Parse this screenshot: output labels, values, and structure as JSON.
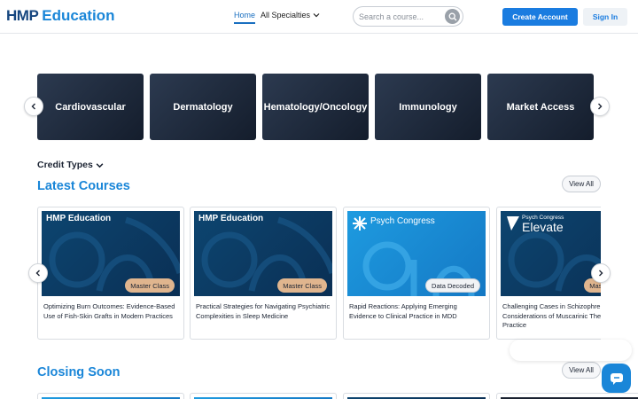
{
  "header": {
    "logo_prefix": "HMP",
    "logo_suffix": "Education",
    "nav": {
      "home": "Home",
      "specialties": "All Specialties"
    },
    "search_placeholder": "Search a course...",
    "create_account": "Create Account",
    "sign_in": "Sign In"
  },
  "specialties": [
    "Cardiovascular",
    "Dermatology",
    "Hematology/Oncology",
    "Immunology",
    "Market Access"
  ],
  "credit_types": "Credit Types",
  "latest": {
    "title": "Latest Courses",
    "view_all": "View All",
    "courses": [
      {
        "brand": "HMP Education",
        "badge": "Master Class",
        "title": "Optimizing Burn Outcomes: Evidence-Based Use of Fish-Skin Grafts in Modern Practices"
      },
      {
        "brand": "HMP Education",
        "badge": "Master Class",
        "title": "Practical Strategies for Navigating Psychiatric Complexities in Sleep Medicine"
      },
      {
        "brand": "Psych Congress",
        "badge": "Data Decoded",
        "title": "Rapid Reactions: Applying Emerging Evidence to Clinical Practice in MDD"
      },
      {
        "brand_small": "Psych Congress",
        "brand": "Elevate",
        "badge": "Master Class",
        "title": "Challenging Cases in Schizophrenia: Practical Considerations of Muscarinic Therapies in Practice"
      }
    ]
  },
  "closing": {
    "title": "Closing Soon",
    "view_all": "View All"
  },
  "colors": {
    "accent": "#1a86d8",
    "primary_button": "#1a7ce0",
    "badge_master_class": "#e0b58e"
  },
  "icons": [
    "search-icon",
    "chevron-down-icon",
    "chevron-left-icon",
    "chevron-right-icon",
    "chat-icon"
  ]
}
